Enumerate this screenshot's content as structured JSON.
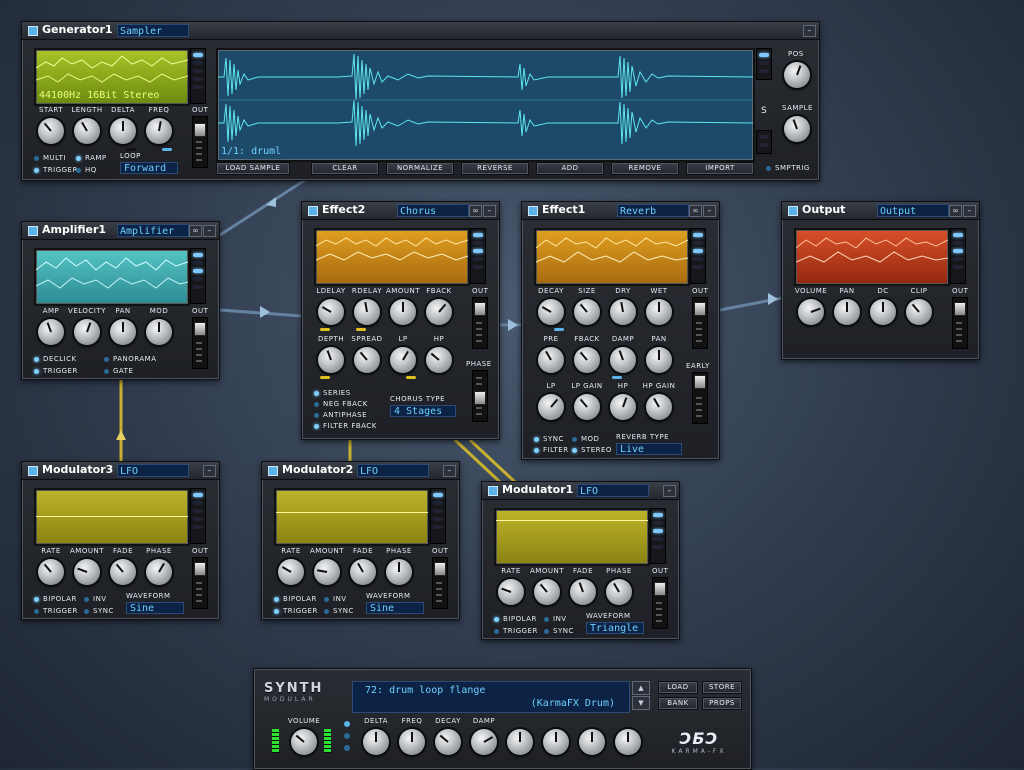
{
  "colors": {
    "accent": "#5ab2e8",
    "lcd_text": "#6dd0ff",
    "cable": "#c8b030"
  },
  "generator": {
    "name": "Generator1",
    "type": "Sampler",
    "info": "44100Hz 16Bit Stereo",
    "knobs": [
      "START",
      "LENGTH",
      "DELTA",
      "FREQ"
    ],
    "out": "OUT",
    "pos": "POS",
    "sample": "SAMPLE",
    "s": "S",
    "options": [
      "MULTI",
      "TRIGGER",
      "RAMP",
      "HQ"
    ],
    "loop_label": "LOOP",
    "loop_value": "Forward",
    "sample_name": "1/1: druml",
    "smptrig": "SMPTRIG",
    "buttons": [
      "LOAD SAMPLE",
      "CLEAR",
      "NORMALIZE",
      "REVERSE",
      "ADD",
      "REMOVE",
      "IMPORT"
    ]
  },
  "amplifier": {
    "name": "Amplifier1",
    "type": "Amplifier",
    "knobs": [
      "AMP",
      "VELOCITY",
      "PAN",
      "MOD"
    ],
    "out": "OUT",
    "options": [
      "DECLICK",
      "TRIGGER",
      "PANORAMA",
      "GATE"
    ]
  },
  "effect2": {
    "name": "Effect2",
    "type": "Chorus",
    "knobs1": [
      "LDELAY",
      "RDELAY",
      "AMOUNT",
      "FBACK"
    ],
    "knobs2": [
      "DEPTH",
      "SPREAD",
      "LP",
      "HP"
    ],
    "out": "OUT",
    "phase": "PHASE",
    "options": [
      "SERIES",
      "NEG FBACK",
      "ANTIPHASE",
      "FILTER FBACK"
    ],
    "sel_label": "CHORUS TYPE",
    "sel_value": "4 Stages"
  },
  "effect1": {
    "name": "Effect1",
    "type": "Reverb",
    "knobs1": [
      "DECAY",
      "SIZE",
      "DRY",
      "WET"
    ],
    "knobs2": [
      "PRE",
      "FBACK",
      "DAMP",
      "PAN"
    ],
    "knobs3": [
      "LP",
      "LP GAIN",
      "HP",
      "HP GAIN"
    ],
    "out": "OUT",
    "early": "EARLY",
    "options": [
      "SYNC",
      "FILTER",
      "MOD",
      "STEREO"
    ],
    "sel_label": "REVERB TYPE",
    "sel_value": "Live"
  },
  "output": {
    "name": "Output",
    "type": "Output",
    "knobs": [
      "VOLUME",
      "PAN",
      "DC",
      "CLIP"
    ],
    "out": "OUT"
  },
  "mod3": {
    "name": "Modulator3",
    "type": "LFO",
    "knobs": [
      "RATE",
      "AMOUNT",
      "FADE",
      "PHASE"
    ],
    "out": "OUT",
    "options": [
      "BIPOLAR",
      "TRIGGER",
      "INV",
      "SYNC"
    ],
    "wave_label": "WAVEFORM",
    "wave_value": "Sine"
  },
  "mod2": {
    "name": "Modulator2",
    "type": "LFO",
    "knobs": [
      "RATE",
      "AMOUNT",
      "FADE",
      "PHASE"
    ],
    "out": "OUT",
    "options": [
      "BIPOLAR",
      "TRIGGER",
      "INV",
      "SYNC"
    ],
    "wave_label": "WAVEFORM",
    "wave_value": "Sine"
  },
  "mod1": {
    "name": "Modulator1",
    "type": "LFO",
    "knobs": [
      "RATE",
      "AMOUNT",
      "FADE",
      "PHASE"
    ],
    "out": "OUT",
    "options": [
      "BIPOLAR",
      "TRIGGER",
      "INV",
      "SYNC"
    ],
    "wave_label": "WAVEFORM",
    "wave_value": "Triangle"
  },
  "master": {
    "logo_top": "SYNTH",
    "logo_bottom": "MODULAR",
    "patch_line1": "72: drum loop flange",
    "patch_line2": "(KarmaFX Drum)",
    "knobs": [
      "VOLUME",
      "DELTA",
      "FREQ",
      "DECAY",
      "DAMP"
    ],
    "buttons": [
      "LOAD",
      "STORE",
      "BANK",
      "PROPS"
    ],
    "brand": "KARMA-FX",
    "brand_mark": "ƆƂƆ"
  }
}
